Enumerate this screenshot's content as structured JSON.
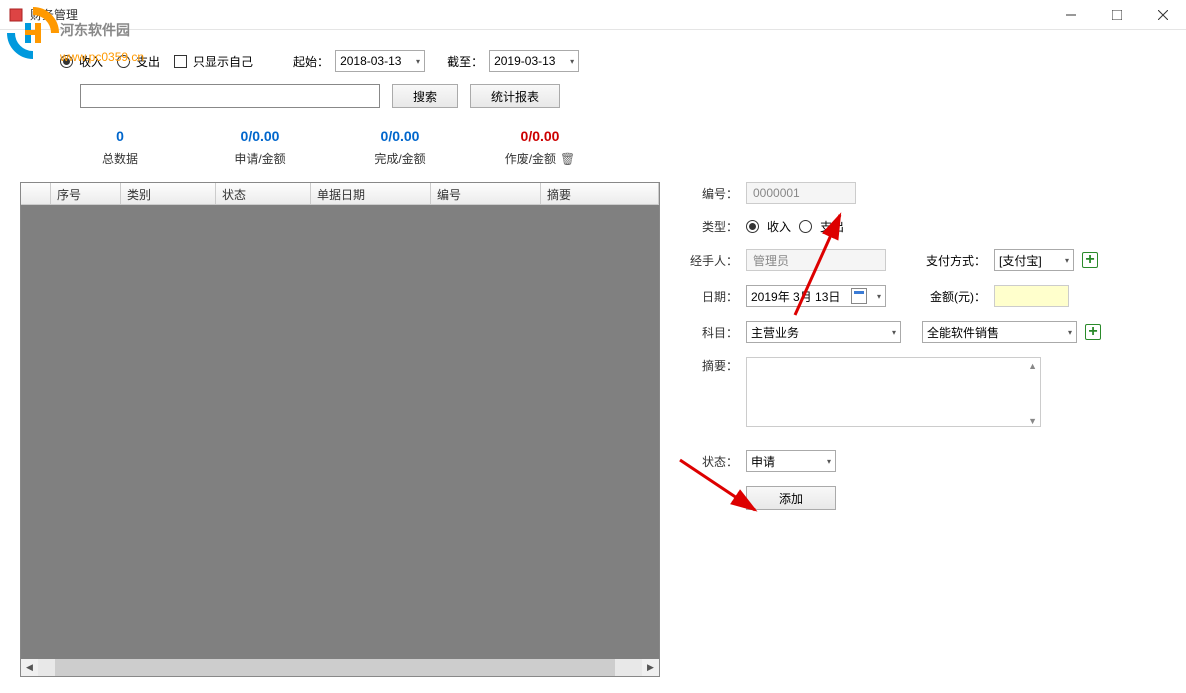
{
  "window": {
    "title": "财务管理"
  },
  "watermark": {
    "site_name": "河东软件园",
    "url": "www.pc0359.cn"
  },
  "filters": {
    "income_label": "收入",
    "expense_label": "支出",
    "only_self_label": "只显示自己",
    "start_label": "起始：",
    "start_date": "2018-03-13",
    "end_label": "截至：",
    "end_date": "2019-03-13"
  },
  "search": {
    "search_btn": "搜索",
    "report_btn": "统计报表"
  },
  "stats": {
    "total": {
      "value": "0",
      "label": "总数据"
    },
    "apply": {
      "value": "0/0.00",
      "label": "申请/金额"
    },
    "done": {
      "value": "0/0.00",
      "label": "完成/金额"
    },
    "void": {
      "value": "0/0.00",
      "label": "作废/金额"
    }
  },
  "table": {
    "columns": [
      "序号",
      "类别",
      "状态",
      "单据日期",
      "编号",
      "摘要"
    ]
  },
  "form": {
    "number_label": "编号：",
    "number_value": "0000001",
    "type_label": "类型：",
    "type_income": "收入",
    "type_expense": "支出",
    "handler_label": "经手人：",
    "handler_value": "管理员",
    "payment_label": "支付方式：",
    "payment_value": "[支付宝]",
    "date_label": "日期：",
    "date_value": "2019年 3月 13日",
    "amount_label": "金额(元)：",
    "amount_value": "",
    "subject_label": "科目：",
    "subject_value": "主营业务",
    "subject2_value": "全能软件销售",
    "summary_label": "摘要：",
    "status_label": "状态：",
    "status_value": "申请",
    "add_btn": "添加"
  }
}
